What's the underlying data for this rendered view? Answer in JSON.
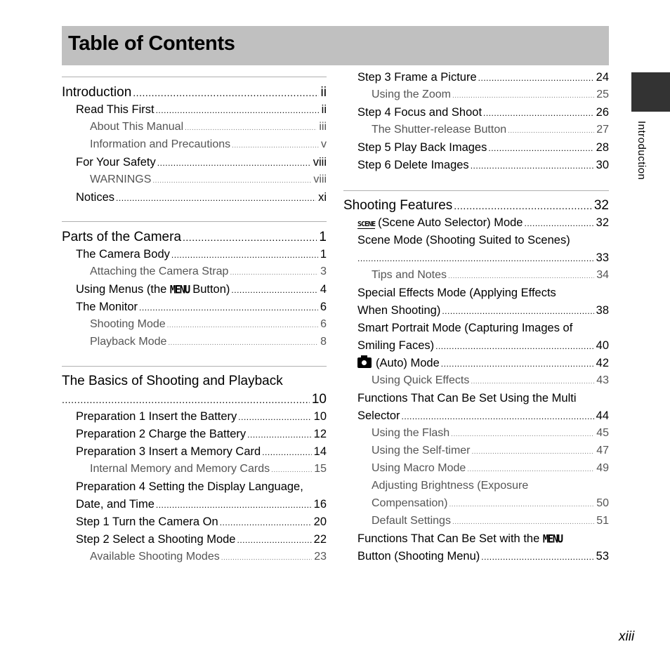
{
  "title": "Table of Contents",
  "side_tab": {
    "label": "Introduction",
    "color": "#333333"
  },
  "page_number": "xiii",
  "left": {
    "sections": [
      {
        "heading": {
          "text": "Introduction",
          "page": "ii"
        },
        "entries": [
          {
            "level": 1,
            "text": "Read This First",
            "page": "ii"
          },
          {
            "level": 2,
            "text": "About This Manual",
            "page": "iii"
          },
          {
            "level": 2,
            "text": "Information and Precautions",
            "page": "v"
          },
          {
            "level": 1,
            "text": "For Your Safety",
            "page": "viii"
          },
          {
            "level": 2,
            "text": "WARNINGS",
            "page": "viii"
          },
          {
            "level": 1,
            "text": "Notices",
            "page": "xi"
          }
        ]
      },
      {
        "heading": {
          "text": "Parts of the Camera",
          "page": "1"
        },
        "entries": [
          {
            "level": 1,
            "text": "The Camera Body",
            "page": "1"
          },
          {
            "level": 2,
            "text": "Attaching the Camera Strap",
            "page": "3"
          },
          {
            "level": 1,
            "text_before": "Using Menus (the ",
            "glyph": "MENU",
            "text_after": " Button)",
            "page": "4"
          },
          {
            "level": 1,
            "text": "The Monitor",
            "page": "6"
          },
          {
            "level": 2,
            "text": "Shooting Mode",
            "page": "6"
          },
          {
            "level": 2,
            "text": "Playback Mode",
            "page": "8"
          }
        ]
      },
      {
        "heading": {
          "line1": "The Basics of Shooting and Playback",
          "page": "10"
        },
        "entries": [
          {
            "level": 1,
            "text": "Preparation 1 Insert the Battery",
            "page": "10"
          },
          {
            "level": 1,
            "text": "Preparation 2 Charge the Battery",
            "page": "12"
          },
          {
            "level": 1,
            "text": "Preparation 3 Insert a Memory Card",
            "page": "14"
          },
          {
            "level": 2,
            "text": "Internal Memory and Memory Cards",
            "page": "15"
          },
          {
            "level": 1,
            "line1": "Preparation 4 Setting the Display Language,",
            "line2": "Date, and Time",
            "page": "16"
          },
          {
            "level": 1,
            "text": "Step 1 Turn the Camera On",
            "page": "20"
          },
          {
            "level": 1,
            "text": "Step 2 Select a Shooting Mode",
            "page": "22"
          },
          {
            "level": 2,
            "text": "Available Shooting Modes",
            "page": "23"
          }
        ]
      }
    ]
  },
  "right": {
    "top_entries": [
      {
        "level": 1,
        "text": "Step 3 Frame a Picture",
        "page": "24"
      },
      {
        "level": 2,
        "text": "Using the Zoom",
        "page": "25"
      },
      {
        "level": 1,
        "text": "Step 4 Focus and Shoot",
        "page": "26"
      },
      {
        "level": 2,
        "text": "The Shutter-release Button",
        "page": "27"
      },
      {
        "level": 1,
        "text": "Step 5 Play Back Images",
        "page": "28"
      },
      {
        "level": 1,
        "text": "Step 6 Delete Images",
        "page": "30"
      }
    ],
    "section": {
      "heading": {
        "text": "Shooting Features",
        "page": "32"
      },
      "entries": [
        {
          "level": 1,
          "icon": "SCENE",
          "text": "(Scene Auto Selector) Mode",
          "page": "32"
        },
        {
          "level": 1,
          "line1": "Scene Mode (Shooting Suited to Scenes)",
          "line2": "",
          "page": "33"
        },
        {
          "level": 2,
          "text": "Tips and Notes",
          "page": "34"
        },
        {
          "level": 1,
          "line1": "Special Effects Mode (Applying Effects",
          "line2": "When Shooting)",
          "page": "38"
        },
        {
          "level": 1,
          "line1": "Smart Portrait Mode (Capturing Images of",
          "line2": "Smiling Faces)",
          "page": "40"
        },
        {
          "level": 1,
          "icon": "camera",
          "text": "(Auto) Mode",
          "page": "42"
        },
        {
          "level": 2,
          "text": "Using Quick Effects",
          "page": "43"
        },
        {
          "level": 1,
          "line1": "Functions That Can Be Set Using the Multi",
          "line2": "Selector",
          "page": "44"
        },
        {
          "level": 2,
          "text": "Using the Flash",
          "page": "45"
        },
        {
          "level": 2,
          "text": "Using the Self-timer",
          "page": "47"
        },
        {
          "level": 2,
          "text": "Using Macro Mode",
          "page": "49"
        },
        {
          "level": 2,
          "line1": "Adjusting Brightness (Exposure",
          "line2": "Compensation)",
          "page": "50"
        },
        {
          "level": 2,
          "text": "Default Settings",
          "page": "51"
        },
        {
          "level": 1,
          "line1_before": "Functions That Can Be Set with the ",
          "glyph": "MENU",
          "line2": "Button (Shooting Menu)",
          "page": "53"
        }
      ]
    }
  }
}
